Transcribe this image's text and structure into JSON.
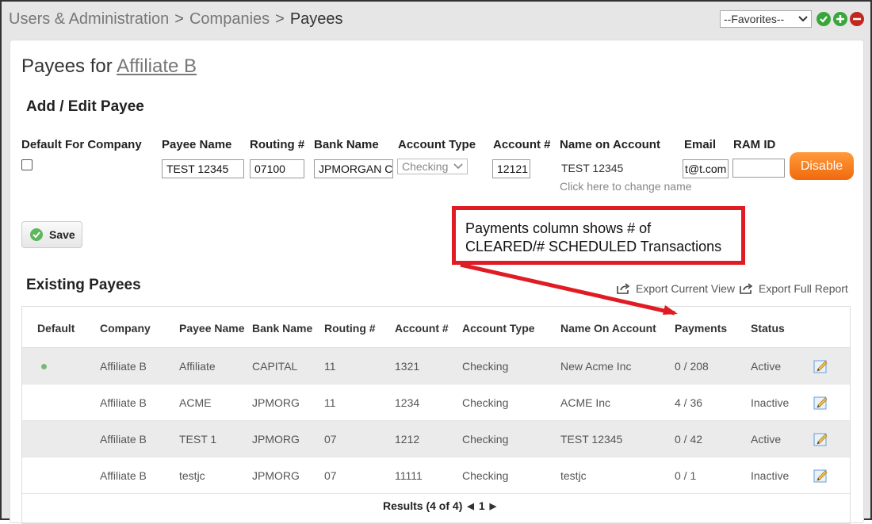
{
  "breadcrumb": {
    "items": [
      "Users & Administration",
      "Companies"
    ],
    "separator": ">",
    "current": "Payees"
  },
  "favorites": {
    "selected": "--Favorites--"
  },
  "page": {
    "title_prefix": "Payees for",
    "title_link": "Affiliate B"
  },
  "form": {
    "section_title": "Add / Edit Payee",
    "labels": {
      "default_for_company": "Default For Company",
      "payee_name": "Payee Name",
      "routing": "Routing #",
      "bank_name": "Bank Name",
      "account_type": "Account Type",
      "account": "Account #",
      "name_on_account": "Name on Account",
      "email": "Email",
      "ram_id": "RAM ID"
    },
    "values": {
      "payee_name": "TEST 12345",
      "routing": "07100",
      "bank_name": "JPMORGAN C",
      "account_type": "Checking",
      "account": "12121",
      "name_on_account": "TEST 12345",
      "email": "t@t.com",
      "ram_id": ""
    },
    "change_name_link": "Click here to change name",
    "disable_button": "Disable",
    "save_button": "Save"
  },
  "annotation": {
    "line1": "Payments column shows # of",
    "line2": "CLEARED/# SCHEDULED Transactions"
  },
  "existing": {
    "section_title": "Existing Payees",
    "export_current": "Export Current View",
    "export_full": "Export Full Report",
    "columns": [
      "Default",
      "Company",
      "Payee Name",
      "Bank Name",
      "Routing #",
      "Account #",
      "Account Type",
      "Name On Account",
      "Payments",
      "Status"
    ],
    "rows": [
      {
        "default": true,
        "company": "Affiliate B",
        "payee": "Affiliate",
        "bank": "CAPITAL",
        "routing": "11",
        "account": "1321",
        "type": "Checking",
        "name": "New Acme Inc",
        "payments": "0 / 208",
        "status": "Active"
      },
      {
        "default": false,
        "company": "Affiliate B",
        "payee": "ACME",
        "bank": "JPMORG",
        "routing": "11",
        "account": "1234",
        "type": "Checking",
        "name": "ACME Inc",
        "payments": "4 / 36",
        "status": "Inactive"
      },
      {
        "default": false,
        "company": "Affiliate B",
        "payee": "TEST 1",
        "bank": "JPMORG",
        "routing": "07",
        "account": "1212",
        "type": "Checking",
        "name": "TEST 12345",
        "payments": "0 / 42",
        "status": "Active"
      },
      {
        "default": false,
        "company": "Affiliate B",
        "payee": "testjc",
        "bank": "JPMORG",
        "routing": "07",
        "account": "11111",
        "type": "Checking",
        "name": "testjc",
        "payments": "0 / 1",
        "status": "Inactive"
      }
    ],
    "results_text": "Results (4 of 4)",
    "page_number": "1"
  },
  "colors": {
    "accent_orange": "#f06a0c",
    "annotation_red": "#e01b24",
    "status_green": "#7ab87a"
  }
}
